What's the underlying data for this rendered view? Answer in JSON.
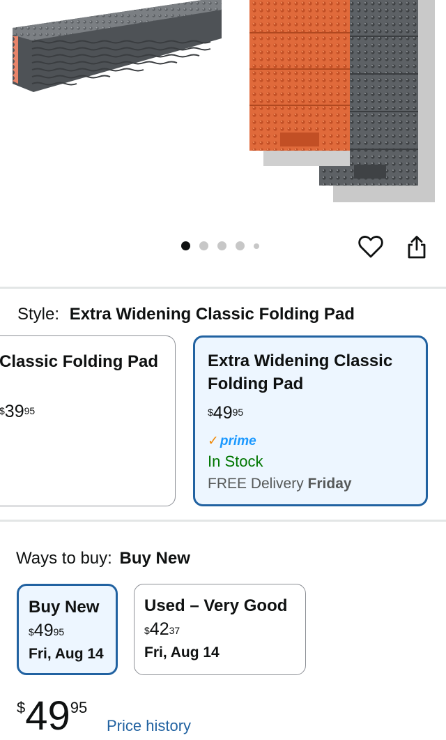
{
  "gallery": {
    "image_alt": "Folding foam sleeping pads",
    "dots_count": 5,
    "active_dot": 0
  },
  "actions": {
    "favorite_icon": "heart-icon",
    "share_icon": "share-icon"
  },
  "style": {
    "label": "Style:",
    "selected": "Extra Widening Classic Folding Pad",
    "options": [
      {
        "title": "Classic Folding Pad",
        "price_currency": "$",
        "price_whole": "39",
        "price_fraction": "95"
      },
      {
        "title": "Extra Widening Classic Folding Pad",
        "price_currency": "$",
        "price_whole": "49",
        "price_fraction": "95",
        "prime_check": "✓",
        "prime_label": "prime",
        "stock": "In Stock",
        "delivery_prefix": "FREE Delivery",
        "delivery_day": "Friday"
      }
    ]
  },
  "ways_to_buy": {
    "label": "Ways to buy:",
    "selected": "Buy New",
    "options": [
      {
        "title": "Buy New",
        "price_currency": "$",
        "price_whole": "49",
        "price_fraction": "95",
        "date": "Fri, Aug 14"
      },
      {
        "title": "Used – Very Good",
        "price_currency": "$",
        "price_whole": "42",
        "price_fraction": "37",
        "date": "Fri, Aug 14"
      }
    ]
  },
  "price": {
    "currency": "$",
    "whole": "49",
    "fraction": "95",
    "history_link": "Price history"
  },
  "colors": {
    "accent_blue": "#2162a1",
    "selected_bg": "#edf6ff",
    "in_stock_green": "#007600",
    "prime_blue": "#1a98ff",
    "prime_check_orange": "#f08804",
    "pad_orange": "#e2663a",
    "pad_gray": "#6a6d70"
  }
}
